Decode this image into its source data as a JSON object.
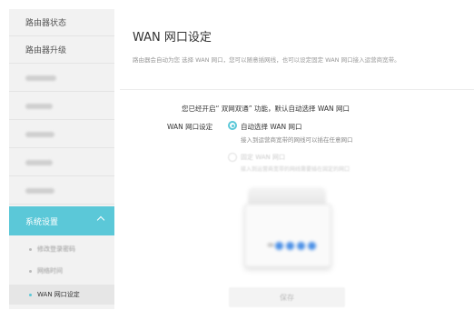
{
  "sidebar": {
    "items": [
      {
        "label": "路由器状态",
        "blurred": false
      },
      {
        "label": "路由器升级",
        "blurred": false
      },
      {
        "label": "",
        "blurred": true
      },
      {
        "label": "",
        "blurred": true
      },
      {
        "label": "",
        "blurred": true
      },
      {
        "label": "",
        "blurred": true
      },
      {
        "label": "",
        "blurred": true
      }
    ],
    "active_section": "系统设置",
    "subitems": [
      "修改登录密码",
      "网络时间",
      "WAN 网口设定"
    ],
    "current_subitem": "WAN 网口设定"
  },
  "main": {
    "title": "WAN 网口设定",
    "description": "路由器会自动为您 选择 WAN 网口，您可以随意插网线，也可以设定固定 WAN 网口接入运营商宽带。",
    "notice": "您已经开启“ 双网双通” 功能，默认自动选择 WAN 网口",
    "setting_label": "WAN 网口设定",
    "options": [
      {
        "label": "自动选择 WAN 网口",
        "sub": "接入到运营商宽带的网线可以插在任意网口",
        "selected": true
      },
      {
        "label": "固定 WAN 网口",
        "sub": "接入到运营商宽带的网线需要插在固定的网口",
        "selected": false
      }
    ],
    "save_label": "保存"
  },
  "colors": {
    "accent": "#5bc8d8",
    "sidebar_bg": "#f2f2f2",
    "led": "#4a8fe6"
  }
}
